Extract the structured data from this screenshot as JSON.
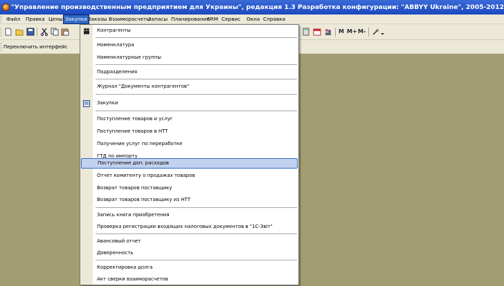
{
  "window": {
    "title": "\"Управление производственным предприятием для Украины\", редакция 1.3 Разработка конфигурации: \"ABBYY Ukraine\", 2005-2012 / Ирина /",
    "app_icon": "1c-app-icon"
  },
  "menubar": {
    "items": [
      {
        "label": "Файл"
      },
      {
        "label": "Правка"
      },
      {
        "label": "Цены"
      },
      {
        "label": "Закупки"
      },
      {
        "label": "Заказы"
      },
      {
        "label": "Взаиморасчеты"
      },
      {
        "label": "Запасы"
      },
      {
        "label": "Планирование"
      },
      {
        "label": "SRM"
      },
      {
        "label": "Сервис"
      },
      {
        "label": "Окна"
      },
      {
        "label": "Справка"
      }
    ],
    "active": "Закупки"
  },
  "toolbar": {
    "icons": [
      "new-document-icon",
      "open-folder-icon",
      "save-icon",
      "cut-icon",
      "copy-icon",
      "paste-icon",
      "calculator-icon",
      "calendar-icon",
      "users-icon",
      "wizard-icon"
    ],
    "memory_buttons": {
      "m": "M",
      "m_plus": "M+",
      "m_minus": "M-"
    }
  },
  "toolbar2": {
    "switch_interface_label": "Переключить интерфейс"
  },
  "purchases_menu": {
    "items": [
      {
        "label": "Контрагенты"
      },
      {
        "label": "Номенклатура"
      },
      {
        "label": "Номенклатурные группы"
      },
      {
        "label": "Подразделения"
      },
      {
        "label": "Журнал \"Документы контрагентов\""
      },
      {
        "label": "Закупки",
        "icon": "journal-icon"
      },
      {
        "label": "Поступление товаров и услуг"
      },
      {
        "label": "Поступление товаров в НТТ"
      },
      {
        "label": "Получение услуг по переработке"
      },
      {
        "label": "ГТД по импорту"
      },
      {
        "label": "Поступление доп. расходов",
        "highlighted": true
      },
      {
        "label": "Отчет комитенту о продажах товаров"
      },
      {
        "label": "Возврат товаров поставщику"
      },
      {
        "label": "Возврат товаров поставщику из НТТ"
      },
      {
        "label": "Запись книги приобретения"
      },
      {
        "label": "Проверка регистрации входящих налоговых документов в \"1С-Звіт\""
      },
      {
        "label": "Авансовый отчет"
      },
      {
        "label": "Доверенность"
      },
      {
        "label": "Корректировка долга"
      },
      {
        "label": "Акт сверки взаиморасчетов"
      }
    ]
  },
  "colors": {
    "workspace": "#a39d72",
    "menu_highlight": "#c1d2ee",
    "menu_highlight_border": "#316ac5",
    "titlebar": "#1c48bf"
  }
}
